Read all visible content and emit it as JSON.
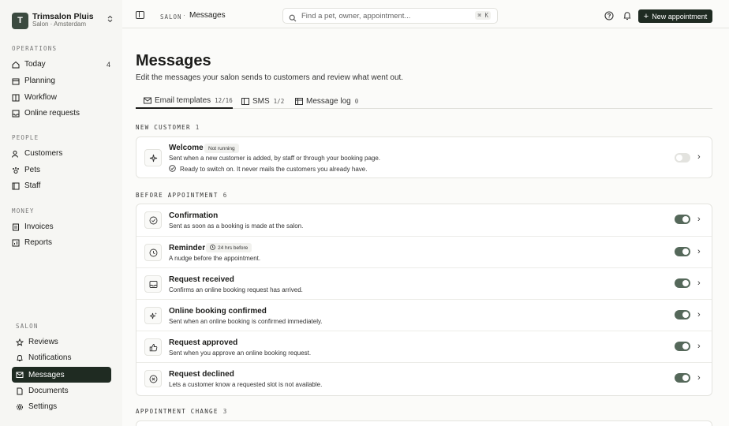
{
  "brand": {
    "initial": "T",
    "name": "Trimsalon Pluis",
    "sub": "Salon · Amsterdam"
  },
  "sidebar": {
    "sections": [
      "OPERATIONS",
      "PEOPLE",
      "MONEY",
      "SALON"
    ],
    "operations": [
      {
        "label": "Today",
        "count": "4",
        "icon": "home-icon"
      },
      {
        "label": "Planning",
        "icon": "calendar-icon"
      },
      {
        "label": "Workflow",
        "icon": "columns-icon"
      },
      {
        "label": "Online requests",
        "icon": "inbox-icon"
      }
    ],
    "people": [
      {
        "label": "Customers",
        "icon": "users-icon"
      },
      {
        "label": "Pets",
        "icon": "paw-icon"
      },
      {
        "label": "Staff",
        "icon": "id-card-icon"
      }
    ],
    "money": [
      {
        "label": "Invoices",
        "icon": "file-text-icon"
      },
      {
        "label": "Reports",
        "icon": "chart-icon"
      }
    ],
    "salon": [
      {
        "label": "Reviews",
        "icon": "star-icon"
      },
      {
        "label": "Notifications",
        "icon": "bell-icon"
      },
      {
        "label": "Messages",
        "icon": "mail-icon",
        "active": true
      },
      {
        "label": "Documents",
        "icon": "document-icon"
      },
      {
        "label": "Settings",
        "icon": "gear-icon"
      }
    ]
  },
  "topbar": {
    "crumb_root": "SALON",
    "crumb_sep": "·",
    "crumb_current": "Messages",
    "search_placeholder": "Find a pet, owner, appointment...",
    "search_kbd": "⌘ K",
    "new_button": "New appointment"
  },
  "page": {
    "title": "Messages",
    "subtitle": "Edit the messages your salon sends to customers and review what went out."
  },
  "tabs": [
    {
      "label": "Email templates",
      "count": "12/16",
      "active": true
    },
    {
      "label": "SMS",
      "count": "1/2"
    },
    {
      "label": "Message log",
      "count": "0"
    }
  ],
  "groups": [
    {
      "label": "NEW CUSTOMER",
      "count": "1",
      "items": [
        {
          "title": "Welcome",
          "badge": "Not running",
          "desc": "Sent when a new customer is added, by staff or through your booking page.",
          "note": "Ready to switch on. It never mails the customers you already have.",
          "enabled": false,
          "icon": "sparkle-icon"
        }
      ]
    },
    {
      "label": "BEFORE APPOINTMENT",
      "count": "6",
      "items": [
        {
          "title": "Confirmation",
          "desc": "Sent as soon as a booking is made at the salon.",
          "enabled": true,
          "icon": "check-circle-icon"
        },
        {
          "title": "Reminder",
          "badge": "24 hrs before",
          "desc": "A nudge before the appointment.",
          "enabled": true,
          "icon": "clock-icon"
        },
        {
          "title": "Request received",
          "desc": "Confirms an online booking request has arrived.",
          "enabled": true,
          "icon": "inbox-icon"
        },
        {
          "title": "Online booking confirmed",
          "desc": "Sent when an online booking is confirmed immediately.",
          "enabled": true,
          "icon": "sparkles-icon"
        },
        {
          "title": "Request approved",
          "desc": "Sent when you approve an online booking request.",
          "enabled": true,
          "icon": "thumbs-up-icon"
        },
        {
          "title": "Request declined",
          "desc": "Lets a customer know a requested slot is not available.",
          "enabled": true,
          "icon": "x-circle-icon"
        }
      ]
    },
    {
      "label": "APPOINTMENT CHANGE",
      "count": "3",
      "items": []
    }
  ],
  "colors": {
    "accent": "#1f2b22",
    "toggle_on": "#55685a",
    "toggle_off": "#e3e3df",
    "background": "#f6f6f3"
  }
}
